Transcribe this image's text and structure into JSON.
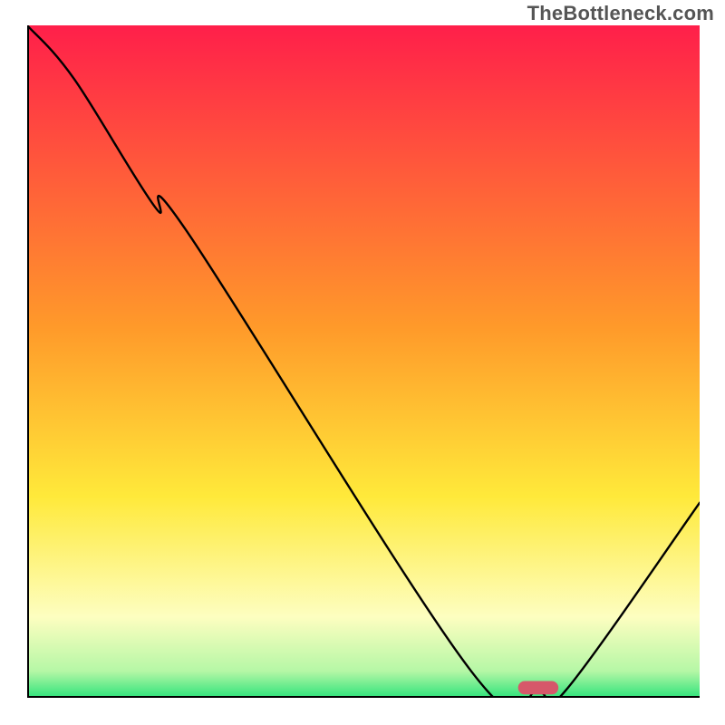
{
  "watermark": "TheBottleneck.com",
  "chart_data": {
    "type": "line",
    "title": "",
    "xlabel": "",
    "ylabel": "",
    "xlim": [
      0,
      100
    ],
    "ylim": [
      0,
      100
    ],
    "grid": false,
    "axes_visible": false,
    "legend": false,
    "background_gradient_stops": [
      {
        "offset": 0.0,
        "color": "#ff1f4a"
      },
      {
        "offset": 0.45,
        "color": "#ff9a2a"
      },
      {
        "offset": 0.7,
        "color": "#ffe93a"
      },
      {
        "offset": 0.88,
        "color": "#fdfec0"
      },
      {
        "offset": 0.96,
        "color": "#b6f7a6"
      },
      {
        "offset": 1.0,
        "color": "#2fe37b"
      }
    ],
    "series": [
      {
        "name": "bottleneck-curve",
        "x": [
          0,
          7,
          19,
          24,
          66,
          76,
          80,
          100
        ],
        "y": [
          100,
          92,
          73,
          69,
          4,
          1,
          1,
          29
        ]
      }
    ],
    "marker": {
      "name": "optimal-point",
      "x": 76,
      "y": 1.5,
      "width": 6,
      "height": 2,
      "color": "#d6586a"
    }
  }
}
